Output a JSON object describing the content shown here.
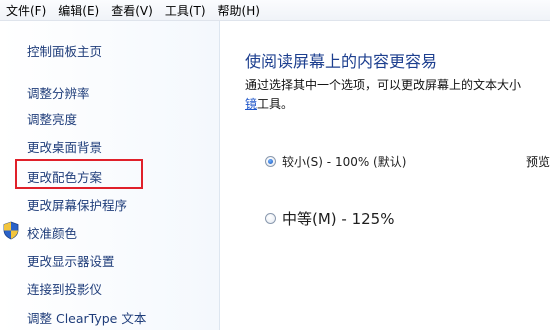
{
  "menu": [
    "文件(F)",
    "编辑(E)",
    "查看(V)",
    "工具(T)",
    "帮助(H)"
  ],
  "sidebar": {
    "items": [
      "控制面板主页",
      "调整分辨率",
      "调整亮度",
      "更改桌面背景",
      "更改配色方案",
      "更改屏幕保护程序",
      "校准颜色",
      "更改显示器设置",
      "连接到投影仪",
      "调整 ClearType 文本"
    ]
  },
  "main": {
    "title": "使阅读屏幕上的内容更容易",
    "desc_line1": "通过选择其中一个选项，可以更改屏幕上的文本大小",
    "desc_link": "镜",
    "desc_tail": "工具。",
    "options": [
      {
        "label": "较小(S) - 100% (默认)",
        "checked": true
      },
      {
        "label": "中等(M) - 125%",
        "checked": false
      }
    ],
    "preview_label": "预览"
  },
  "colors": {
    "highlight": "#e0202a",
    "link": "#1f3d7a",
    "title": "#1d3f8f"
  }
}
